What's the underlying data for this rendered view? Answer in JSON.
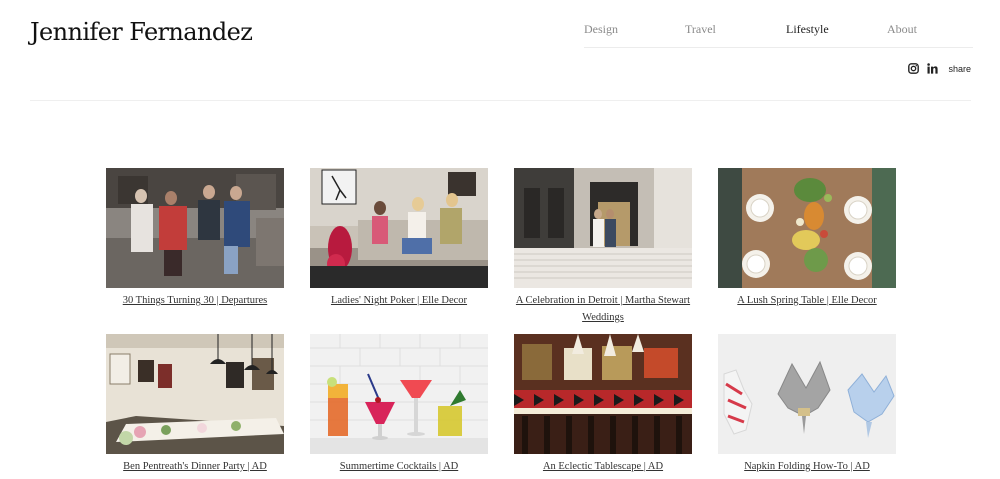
{
  "site": {
    "title": "Jennifer Fernandez"
  },
  "nav": [
    {
      "label": "Design"
    },
    {
      "label": "Travel"
    },
    {
      "label": "Lifestyle"
    },
    {
      "label": "About"
    }
  ],
  "social": {
    "instagram_icon": "instagram-icon",
    "linkedin_icon": "linkedin-icon",
    "share_label": "share"
  },
  "gallery": [
    {
      "caption": "30 Things Turning 30 | Departures"
    },
    {
      "caption": "Ladies' Night Poker | Elle Decor"
    },
    {
      "caption": "A Celebration in Detroit | Martha Stewart Weddings"
    },
    {
      "caption": "A Lush Spring Table | Elle Decor"
    },
    {
      "caption": "Ben Pentreath's Dinner Party | AD"
    },
    {
      "caption": "Summertime Cocktails | AD"
    },
    {
      "caption": "An Eclectic Tablescape | AD"
    },
    {
      "caption": "Napkin Folding How-To | AD"
    }
  ]
}
